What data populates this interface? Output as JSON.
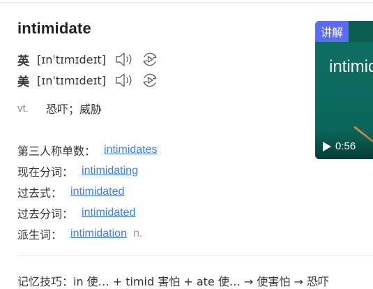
{
  "entry": {
    "word": "intimidate",
    "uk": {
      "label": "英",
      "phonetic": "[ɪnˈtɪmɪdeɪt]"
    },
    "us": {
      "label": "美",
      "phonetic": "[ɪnˈtɪmɪdeɪt]"
    },
    "definition": {
      "pos": "vt.",
      "meaning": "恐吓；威胁"
    }
  },
  "forms": [
    {
      "label": "第三人称单数",
      "sep": "：",
      "value": "intimidates",
      "pos": ""
    },
    {
      "label": "现在分词",
      "sep": "：",
      "value": "intimidating",
      "pos": ""
    },
    {
      "label": "过去式",
      "sep": "：",
      "value": "intimidated",
      "pos": ""
    },
    {
      "label": "过去分词",
      "sep": "：",
      "value": "intimidated",
      "pos": ""
    },
    {
      "label": "派生词",
      "sep": "：",
      "value": "intimidation",
      "pos": "n."
    }
  ],
  "mnemonic": "记忆技巧：in 使… + timid 害怕 + ate 使… → 使害怕 → 恐吓",
  "video": {
    "badge": "讲解",
    "word": "intimid",
    "duration": "0:56"
  },
  "colors": {
    "link": "#3e7ee8",
    "badge": "#5c6cf2",
    "video_bg": "#0c6f62"
  },
  "icons": [
    "speaker-icon",
    "replay-icon",
    "play-icon"
  ]
}
